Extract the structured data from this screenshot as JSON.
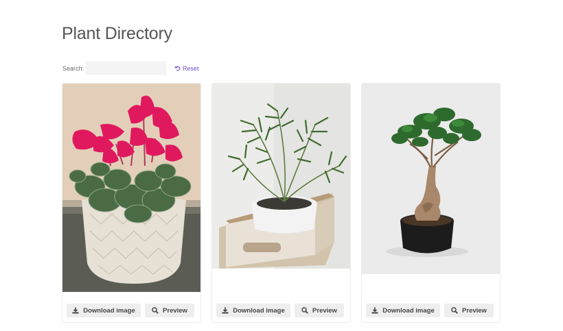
{
  "page": {
    "title": "Plant Directory"
  },
  "search": {
    "label": "Search:",
    "value": "",
    "placeholder": "",
    "reset_label": "Reset"
  },
  "cards": [
    {
      "image_subject": "pink cyclamen in white patterned pot",
      "download_label": "Download image",
      "preview_label": "Preview"
    },
    {
      "image_subject": "palm plant in white pot inside wooden crate",
      "download_label": "Download image",
      "preview_label": "Preview"
    },
    {
      "image_subject": "ficus bonsai in black pot",
      "download_label": "Download image",
      "preview_label": "Preview"
    }
  ],
  "icons": {
    "reset": "undo-icon",
    "download": "download-icon",
    "preview": "search-icon"
  },
  "colors": {
    "accent": "#6f4fc8",
    "button_bg": "#eeeeee",
    "title": "#555555"
  }
}
